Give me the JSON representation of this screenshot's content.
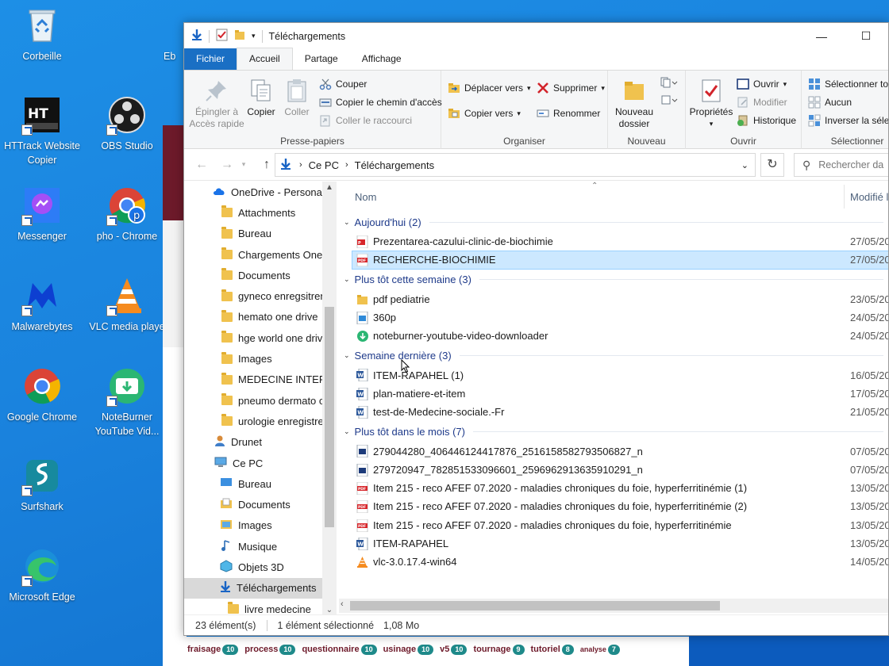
{
  "desktop": {
    "icons": [
      {
        "label": "Corbeille",
        "icon": "recycle-bin-icon"
      },
      {
        "label": "HTTrack Website Copier",
        "icon": "httrack-icon"
      },
      {
        "label": "OBS Studio",
        "icon": "obs-icon"
      },
      {
        "label": "Messenger",
        "icon": "messenger-icon"
      },
      {
        "label": "pho - Chrome",
        "icon": "chrome-profile-icon"
      },
      {
        "label": "Malwarebytes",
        "icon": "malwarebytes-icon"
      },
      {
        "label": "VLC media playe",
        "icon": "vlc-icon"
      },
      {
        "label": "Google Chrome",
        "icon": "chrome-icon"
      },
      {
        "label": "NoteBurner YouTube Vid...",
        "icon": "noteburner-icon"
      },
      {
        "label": "Surfshark",
        "icon": "surfshark-icon"
      },
      {
        "label": "Microsoft Edge",
        "icon": "edge-icon"
      },
      {
        "label": "Eb",
        "icon": "partial-icon"
      }
    ],
    "background_tags": [
      {
        "label": "fraisage",
        "count": "10"
      },
      {
        "label": "process",
        "count": "10"
      },
      {
        "label": "questionnaire",
        "count": "10"
      },
      {
        "label": "usinage",
        "count": "10"
      },
      {
        "label": "v5",
        "count": "10"
      },
      {
        "label": "tournage",
        "count": "9"
      },
      {
        "label": "tutoriel",
        "count": "8"
      },
      {
        "label": "analyse",
        "count": "7"
      }
    ]
  },
  "window": {
    "title": "Téléchargements",
    "tabs": {
      "fichier": "Fichier",
      "accueil": "Accueil",
      "partage": "Partage",
      "affichage": "Affichage"
    },
    "ribbon": {
      "presse_papiers": {
        "label": "Presse-papiers",
        "epingler": "Épingler à Accès rapide",
        "copier": "Copier",
        "coller": "Coller",
        "couper": "Couper",
        "copier_chemin": "Copier le chemin d'accès",
        "coller_raccourci": "Coller le raccourci"
      },
      "organiser": {
        "label": "Organiser",
        "deplacer": "Déplacer vers",
        "copier_vers": "Copier vers",
        "supprimer": "Supprimer",
        "renommer": "Renommer"
      },
      "nouveau": {
        "label": "Nouveau",
        "dossier": "Nouveau dossier"
      },
      "ouvrir": {
        "label": "Ouvrir",
        "proprietes": "Propriétés",
        "ouvrir": "Ouvrir",
        "modifier": "Modifier",
        "historique": "Historique"
      },
      "selectionner": {
        "label": "Sélectionner",
        "tout": "Sélectionner tout",
        "aucun": "Aucun",
        "inverser": "Inverser la sélection"
      }
    },
    "address": {
      "ce_pc": "Ce PC",
      "telechargements": "Téléchargements",
      "search_placeholder": "Rechercher da"
    },
    "nav": [
      {
        "label": "OneDrive - Personal",
        "type": "onedrive",
        "indent": 0
      },
      {
        "label": "Attachments",
        "type": "folder",
        "indent": 1
      },
      {
        "label": "Bureau",
        "type": "folder",
        "indent": 1
      },
      {
        "label": "Chargements OneD",
        "type": "folder",
        "indent": 1
      },
      {
        "label": "Documents",
        "type": "folder",
        "indent": 1
      },
      {
        "label": "gyneco enregsitren",
        "type": "folder",
        "indent": 1
      },
      {
        "label": "hemato one drive",
        "type": "folder",
        "indent": 1
      },
      {
        "label": "hge world one drive",
        "type": "folder",
        "indent": 1
      },
      {
        "label": "Images",
        "type": "folder",
        "indent": 1
      },
      {
        "label": "MEDECINE INTERN",
        "type": "folder",
        "indent": 1
      },
      {
        "label": "pneumo dermato c",
        "type": "folder",
        "indent": 1
      },
      {
        "label": "urologie enregistre",
        "type": "folder",
        "indent": 1
      },
      {
        "label": "Drunet",
        "type": "user",
        "indent": 0
      },
      {
        "label": "Ce PC",
        "type": "pc",
        "indent": 0
      },
      {
        "label": "Bureau",
        "type": "desktop",
        "indent": 1
      },
      {
        "label": "Documents",
        "type": "documents",
        "indent": 1
      },
      {
        "label": "Images",
        "type": "images",
        "indent": 1
      },
      {
        "label": "Musique",
        "type": "music",
        "indent": 1
      },
      {
        "label": "Objets 3D",
        "type": "objects3d",
        "indent": 1
      },
      {
        "label": "Téléchargements",
        "type": "download",
        "indent": 1,
        "selected": true
      },
      {
        "label": "livre medecine",
        "type": "folder",
        "indent": 2
      }
    ],
    "columns": {
      "nom": "Nom",
      "modifie": "Modifié l"
    },
    "groups": [
      {
        "title": "Aujourd'hui (2)",
        "files": [
          {
            "name": "Prezentarea-cazului-clinic-de-biochimie",
            "date": "27/05/20",
            "type": "pdf-red"
          },
          {
            "name": "RECHERCHE-BIOCHIMIE",
            "date": "27/05/20",
            "type": "pdf",
            "selected": true
          }
        ]
      },
      {
        "title": "Plus tôt cette semaine (3)",
        "files": [
          {
            "name": "pdf pediatrie",
            "date": "23/05/20",
            "type": "folder"
          },
          {
            "name": "360p",
            "date": "24/05/20",
            "type": "image"
          },
          {
            "name": "noteburner-youtube-video-downloader",
            "date": "24/05/20",
            "type": "noteburner"
          }
        ]
      },
      {
        "title": "Semaine dernière (3)",
        "files": [
          {
            "name": "ITEM-RAPAHEL (1)",
            "date": "16/05/20",
            "type": "word"
          },
          {
            "name": "plan-matiere-et-item",
            "date": "17/05/20",
            "type": "word"
          },
          {
            "name": "test-de-Medecine-sociale.-Fr",
            "date": "21/05/20",
            "type": "word"
          }
        ]
      },
      {
        "title": "Plus tôt dans le mois (7)",
        "files": [
          {
            "name": "279044280_406446124417876_2516158582793506827_n",
            "date": "07/05/20",
            "type": "image"
          },
          {
            "name": "279720947_782851533096601_2596962913635910291_n",
            "date": "07/05/20",
            "type": "image"
          },
          {
            "name": "Item 215 - reco AFEF 07.2020 - maladies chroniques du foie, hyperferritinémie (1)",
            "date": "13/05/20",
            "type": "pdf"
          },
          {
            "name": "Item 215 - reco AFEF 07.2020 - maladies chroniques du foie, hyperferritinémie (2)",
            "date": "13/05/20",
            "type": "pdf"
          },
          {
            "name": "Item 215 - reco AFEF 07.2020 - maladies chroniques du foie, hyperferritinémie",
            "date": "13/05/20",
            "type": "pdf"
          },
          {
            "name": "ITEM-RAPAHEL",
            "date": "13/05/20",
            "type": "word"
          },
          {
            "name": "vlc-3.0.17.4-win64",
            "date": "14/05/20",
            "type": "vlc"
          }
        ]
      }
    ],
    "status": {
      "count": "23 élément(s)",
      "selected": "1 élément sélectionné",
      "size": "1,08 Mo"
    }
  }
}
